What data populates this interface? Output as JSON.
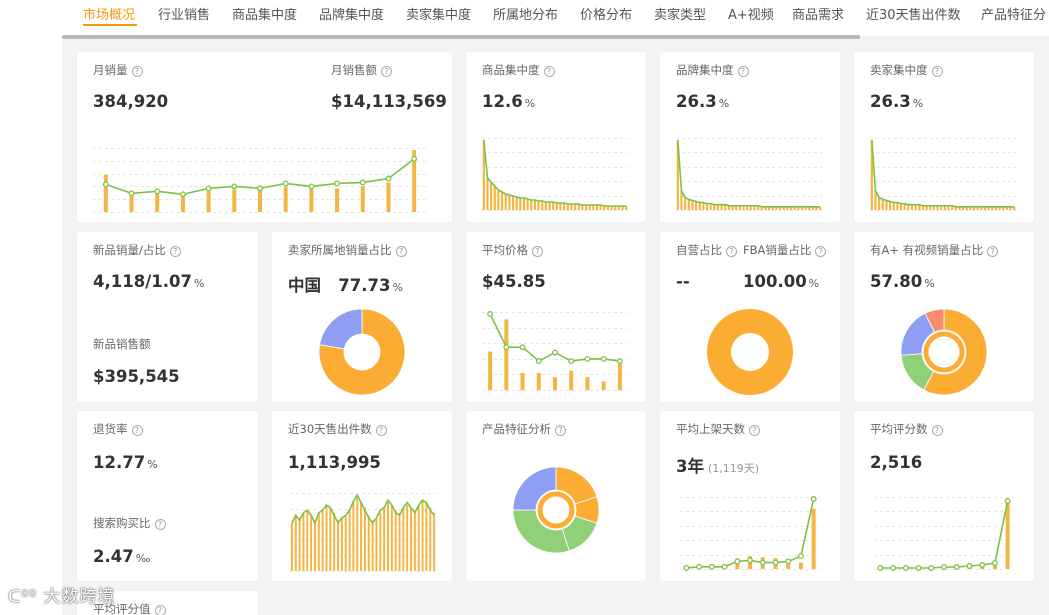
{
  "tabs": [
    {
      "label": "市场概况",
      "active": true
    },
    {
      "label": "行业销售"
    },
    {
      "label": "商品集中度"
    },
    {
      "label": "品牌集中度"
    },
    {
      "label": "卖家集中度"
    },
    {
      "label": "所属地分布"
    },
    {
      "label": "价格分布"
    },
    {
      "label": "卖家类型"
    },
    {
      "label": "A+视频"
    },
    {
      "label": "商品需求"
    },
    {
      "label": "近30天售出件数"
    },
    {
      "label": "产品特征分"
    }
  ],
  "help_icon": "?",
  "colors": {
    "accent": "#f39c12",
    "bar": "#f5b544",
    "line": "#7dc246",
    "donut_orange": "#fbad33",
    "donut_blue": "#8e9ef5",
    "donut_green": "#8fd079",
    "donut_red": "#f98b6c"
  },
  "cards": {
    "monthly_sales": {
      "label": "月销量",
      "value": "384,920"
    },
    "monthly_revenue": {
      "label": "月销售额",
      "value": "$14,113,569"
    },
    "product_conc": {
      "label": "商品集中度",
      "value": "12.6",
      "unit": "%"
    },
    "brand_conc": {
      "label": "品牌集中度",
      "value": "26.3",
      "unit": "%"
    },
    "seller_conc": {
      "label": "卖家集中度",
      "value": "26.3",
      "unit": "%"
    },
    "new_products": {
      "label": "新品销量/占比",
      "value": "4,118/1.07",
      "unit": "%",
      "label2": "新品销售额",
      "value2": "$395,545"
    },
    "seller_location": {
      "label": "卖家所属地销量占比",
      "country": "中国",
      "value": "77.73",
      "unit": "%"
    },
    "avg_price": {
      "label": "平均价格",
      "value": "$45.85"
    },
    "self_fba": {
      "label": "自营占比",
      "label_b": "FBA销量占比",
      "value": "--",
      "value_b": "100.00",
      "unit": "%"
    },
    "aplus_video": {
      "label": "有A+ 有视频销量占比",
      "value": "57.80",
      "unit": "%"
    },
    "return_rate": {
      "label": "退货率",
      "value": "12.77",
      "unit": "%",
      "label2": "搜索购买比",
      "value2": "2.47",
      "unit2": "‰"
    },
    "sold_30d": {
      "label": "近30天售出件数",
      "value": "1,113,995"
    },
    "features": {
      "label": "产品特征分析"
    },
    "avg_days": {
      "label": "平均上架天数",
      "value": "3年",
      "sub": "(1,119天)"
    },
    "avg_reviews": {
      "label": "平均评分数",
      "value": "2,516"
    },
    "avg_rating": {
      "label": "平均评分值"
    }
  },
  "chart_data": [
    {
      "type": "bar",
      "name": "monthly_sales",
      "values": [
        38,
        20,
        21,
        18,
        21,
        23,
        22,
        26,
        24,
        24,
        26,
        30,
        63
      ],
      "line": [
        28,
        19,
        21,
        18,
        24,
        26,
        24,
        29,
        26,
        29,
        30,
        34,
        54
      ]
    },
    {
      "type": "bar",
      "name": "product_conc",
      "values": [
        70,
        32,
        28,
        24,
        20,
        18,
        16,
        15,
        14,
        13,
        12,
        12,
        11,
        10,
        10,
        9,
        9,
        8,
        8,
        8,
        7,
        7,
        7,
        6,
        6,
        6,
        6,
        5,
        5,
        5,
        5,
        5,
        5,
        4,
        4,
        4,
        4,
        4,
        4,
        4
      ]
    },
    {
      "type": "bar",
      "name": "brand_conc",
      "values": [
        66,
        18,
        12,
        10,
        9,
        8,
        7,
        7,
        6,
        6,
        5,
        5,
        5,
        5,
        4,
        4,
        4,
        4,
        4,
        4,
        4,
        4,
        4,
        3,
        3,
        3,
        3,
        3,
        3,
        3,
        3,
        3,
        3,
        3,
        3,
        3,
        3,
        3,
        3,
        3
      ]
    },
    {
      "type": "bar",
      "name": "seller_conc",
      "values": [
        66,
        18,
        12,
        10,
        9,
        8,
        7,
        7,
        6,
        6,
        5,
        5,
        5,
        5,
        4,
        4,
        4,
        4,
        4,
        4,
        4,
        4,
        4,
        3,
        3,
        3,
        3,
        3,
        3,
        3,
        3,
        3,
        3,
        3,
        3,
        3,
        3,
        3,
        3,
        3
      ]
    },
    {
      "type": "pie",
      "name": "seller_location",
      "values": [
        77.73,
        22.27
      ]
    },
    {
      "type": "bar",
      "name": "avg_price",
      "values": [
        36,
        66,
        16,
        16,
        12,
        18,
        12,
        8,
        27
      ],
      "line": [
        71,
        40,
        40,
        27,
        35,
        27,
        29,
        29,
        27
      ]
    },
    {
      "type": "pie",
      "name": "self_fba",
      "values": [
        100
      ]
    },
    {
      "type": "pie",
      "name": "aplus_video",
      "values": [
        57.8,
        16,
        19,
        7.2
      ]
    },
    {
      "type": "bar",
      "name": "sold_30d",
      "values": [
        38,
        44,
        42,
        46,
        48,
        44,
        40,
        46,
        48,
        52,
        50,
        46,
        40,
        42,
        44,
        48,
        55,
        58,
        54,
        50,
        44,
        40,
        42,
        46,
        50,
        54,
        52,
        48,
        46,
        50,
        52,
        50,
        48,
        52,
        56,
        54,
        50,
        46
      ],
      "line": [
        38,
        44,
        40,
        46,
        48,
        44,
        38,
        46,
        48,
        52,
        50,
        44,
        38,
        42,
        44,
        48,
        55,
        60,
        54,
        48,
        42,
        38,
        42,
        48,
        50,
        56,
        52,
        46,
        44,
        50,
        54,
        50,
        46,
        52,
        56,
        54,
        48,
        44
      ]
    },
    {
      "type": "pie",
      "name": "features",
      "values": [
        20,
        10,
        15,
        30,
        25
      ]
    },
    {
      "type": "bar",
      "name": "avg_days",
      "values": [
        1,
        1,
        1,
        2,
        10,
        12,
        11,
        10,
        9,
        6,
        56
      ],
      "line": [
        1,
        2,
        2,
        2,
        7,
        8,
        6,
        6,
        7,
        12,
        65
      ]
    },
    {
      "type": "bar",
      "name": "avg_reviews",
      "values": [
        0,
        0,
        0,
        0,
        0,
        0,
        0,
        1,
        2,
        5,
        70
      ],
      "line": [
        1,
        1,
        1,
        1,
        1,
        2,
        2,
        3,
        4,
        6,
        68
      ]
    }
  ]
}
